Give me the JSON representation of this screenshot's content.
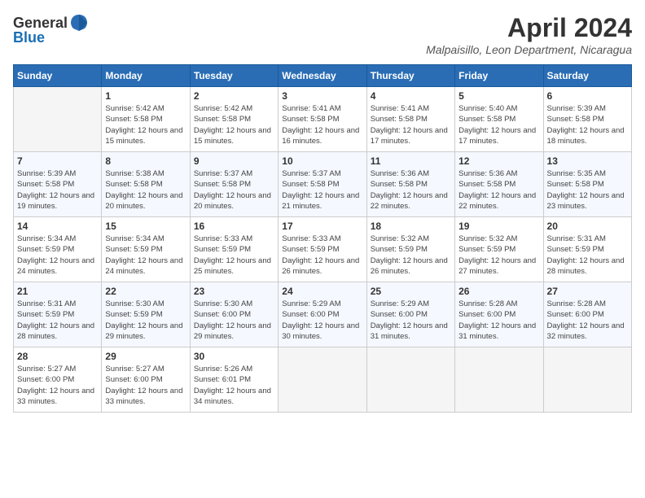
{
  "header": {
    "logo_general": "General",
    "logo_blue": "Blue",
    "month": "April 2024",
    "location": "Malpaisillo, Leon Department, Nicaragua"
  },
  "columns": [
    "Sunday",
    "Monday",
    "Tuesday",
    "Wednesday",
    "Thursday",
    "Friday",
    "Saturday"
  ],
  "weeks": [
    [
      {
        "day": "",
        "sunrise": "",
        "sunset": "",
        "daylight": ""
      },
      {
        "day": "1",
        "sunrise": "Sunrise: 5:42 AM",
        "sunset": "Sunset: 5:58 PM",
        "daylight": "Daylight: 12 hours and 15 minutes."
      },
      {
        "day": "2",
        "sunrise": "Sunrise: 5:42 AM",
        "sunset": "Sunset: 5:58 PM",
        "daylight": "Daylight: 12 hours and 15 minutes."
      },
      {
        "day": "3",
        "sunrise": "Sunrise: 5:41 AM",
        "sunset": "Sunset: 5:58 PM",
        "daylight": "Daylight: 12 hours and 16 minutes."
      },
      {
        "day": "4",
        "sunrise": "Sunrise: 5:41 AM",
        "sunset": "Sunset: 5:58 PM",
        "daylight": "Daylight: 12 hours and 17 minutes."
      },
      {
        "day": "5",
        "sunrise": "Sunrise: 5:40 AM",
        "sunset": "Sunset: 5:58 PM",
        "daylight": "Daylight: 12 hours and 17 minutes."
      },
      {
        "day": "6",
        "sunrise": "Sunrise: 5:39 AM",
        "sunset": "Sunset: 5:58 PM",
        "daylight": "Daylight: 12 hours and 18 minutes."
      }
    ],
    [
      {
        "day": "7",
        "sunrise": "Sunrise: 5:39 AM",
        "sunset": "Sunset: 5:58 PM",
        "daylight": "Daylight: 12 hours and 19 minutes."
      },
      {
        "day": "8",
        "sunrise": "Sunrise: 5:38 AM",
        "sunset": "Sunset: 5:58 PM",
        "daylight": "Daylight: 12 hours and 20 minutes."
      },
      {
        "day": "9",
        "sunrise": "Sunrise: 5:37 AM",
        "sunset": "Sunset: 5:58 PM",
        "daylight": "Daylight: 12 hours and 20 minutes."
      },
      {
        "day": "10",
        "sunrise": "Sunrise: 5:37 AM",
        "sunset": "Sunset: 5:58 PM",
        "daylight": "Daylight: 12 hours and 21 minutes."
      },
      {
        "day": "11",
        "sunrise": "Sunrise: 5:36 AM",
        "sunset": "Sunset: 5:58 PM",
        "daylight": "Daylight: 12 hours and 22 minutes."
      },
      {
        "day": "12",
        "sunrise": "Sunrise: 5:36 AM",
        "sunset": "Sunset: 5:58 PM",
        "daylight": "Daylight: 12 hours and 22 minutes."
      },
      {
        "day": "13",
        "sunrise": "Sunrise: 5:35 AM",
        "sunset": "Sunset: 5:58 PM",
        "daylight": "Daylight: 12 hours and 23 minutes."
      }
    ],
    [
      {
        "day": "14",
        "sunrise": "Sunrise: 5:34 AM",
        "sunset": "Sunset: 5:59 PM",
        "daylight": "Daylight: 12 hours and 24 minutes."
      },
      {
        "day": "15",
        "sunrise": "Sunrise: 5:34 AM",
        "sunset": "Sunset: 5:59 PM",
        "daylight": "Daylight: 12 hours and 24 minutes."
      },
      {
        "day": "16",
        "sunrise": "Sunrise: 5:33 AM",
        "sunset": "Sunset: 5:59 PM",
        "daylight": "Daylight: 12 hours and 25 minutes."
      },
      {
        "day": "17",
        "sunrise": "Sunrise: 5:33 AM",
        "sunset": "Sunset: 5:59 PM",
        "daylight": "Daylight: 12 hours and 26 minutes."
      },
      {
        "day": "18",
        "sunrise": "Sunrise: 5:32 AM",
        "sunset": "Sunset: 5:59 PM",
        "daylight": "Daylight: 12 hours and 26 minutes."
      },
      {
        "day": "19",
        "sunrise": "Sunrise: 5:32 AM",
        "sunset": "Sunset: 5:59 PM",
        "daylight": "Daylight: 12 hours and 27 minutes."
      },
      {
        "day": "20",
        "sunrise": "Sunrise: 5:31 AM",
        "sunset": "Sunset: 5:59 PM",
        "daylight": "Daylight: 12 hours and 28 minutes."
      }
    ],
    [
      {
        "day": "21",
        "sunrise": "Sunrise: 5:31 AM",
        "sunset": "Sunset: 5:59 PM",
        "daylight": "Daylight: 12 hours and 28 minutes."
      },
      {
        "day": "22",
        "sunrise": "Sunrise: 5:30 AM",
        "sunset": "Sunset: 5:59 PM",
        "daylight": "Daylight: 12 hours and 29 minutes."
      },
      {
        "day": "23",
        "sunrise": "Sunrise: 5:30 AM",
        "sunset": "Sunset: 6:00 PM",
        "daylight": "Daylight: 12 hours and 29 minutes."
      },
      {
        "day": "24",
        "sunrise": "Sunrise: 5:29 AM",
        "sunset": "Sunset: 6:00 PM",
        "daylight": "Daylight: 12 hours and 30 minutes."
      },
      {
        "day": "25",
        "sunrise": "Sunrise: 5:29 AM",
        "sunset": "Sunset: 6:00 PM",
        "daylight": "Daylight: 12 hours and 31 minutes."
      },
      {
        "day": "26",
        "sunrise": "Sunrise: 5:28 AM",
        "sunset": "Sunset: 6:00 PM",
        "daylight": "Daylight: 12 hours and 31 minutes."
      },
      {
        "day": "27",
        "sunrise": "Sunrise: 5:28 AM",
        "sunset": "Sunset: 6:00 PM",
        "daylight": "Daylight: 12 hours and 32 minutes."
      }
    ],
    [
      {
        "day": "28",
        "sunrise": "Sunrise: 5:27 AM",
        "sunset": "Sunset: 6:00 PM",
        "daylight": "Daylight: 12 hours and 33 minutes."
      },
      {
        "day": "29",
        "sunrise": "Sunrise: 5:27 AM",
        "sunset": "Sunset: 6:00 PM",
        "daylight": "Daylight: 12 hours and 33 minutes."
      },
      {
        "day": "30",
        "sunrise": "Sunrise: 5:26 AM",
        "sunset": "Sunset: 6:01 PM",
        "daylight": "Daylight: 12 hours and 34 minutes."
      },
      {
        "day": "",
        "sunrise": "",
        "sunset": "",
        "daylight": ""
      },
      {
        "day": "",
        "sunrise": "",
        "sunset": "",
        "daylight": ""
      },
      {
        "day": "",
        "sunrise": "",
        "sunset": "",
        "daylight": ""
      },
      {
        "day": "",
        "sunrise": "",
        "sunset": "",
        "daylight": ""
      }
    ]
  ]
}
